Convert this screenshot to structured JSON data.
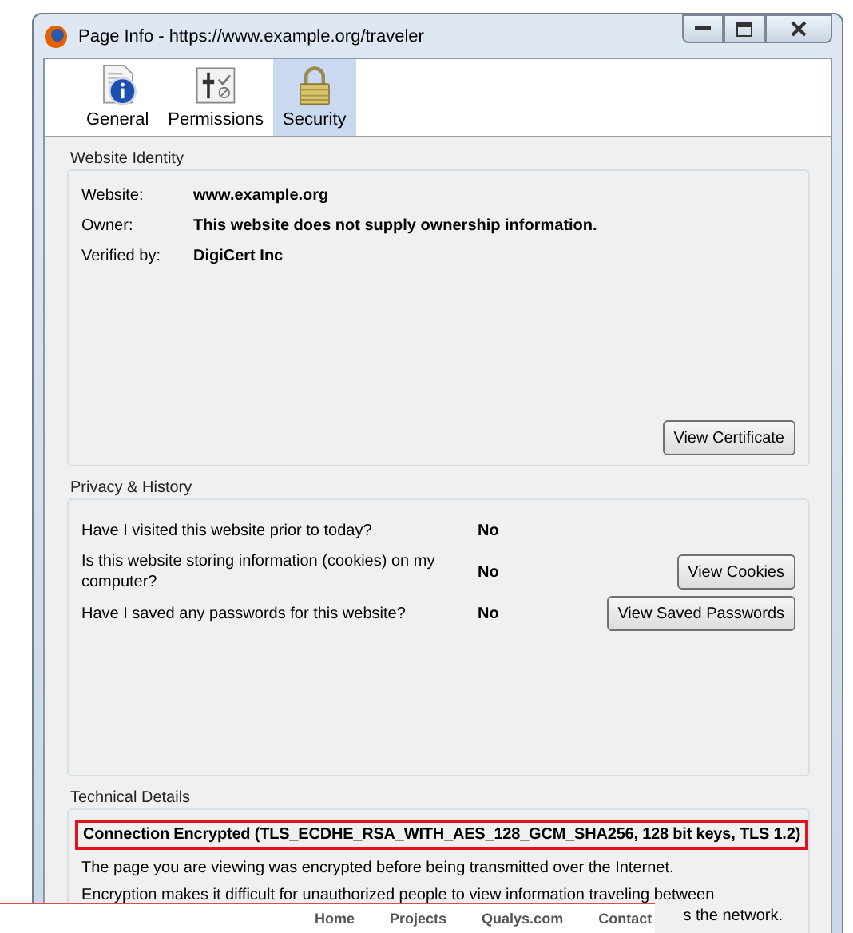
{
  "window": {
    "title": "Page Info - https://www.example.org/traveler"
  },
  "tabs": [
    {
      "label": "General",
      "kind": "info",
      "selected": false
    },
    {
      "label": "Permissions",
      "kind": "permissions",
      "selected": false
    },
    {
      "label": "Security",
      "kind": "lock",
      "selected": true
    }
  ],
  "identity": {
    "title": "Website Identity",
    "fields": [
      {
        "label": "Website:",
        "value": "www.example.org"
      },
      {
        "label": "Owner:",
        "value": "This website does not supply ownership information."
      },
      {
        "label": "Verified by:",
        "value": "DigiCert Inc"
      }
    ],
    "button": "View Certificate"
  },
  "privacy": {
    "title": "Privacy & History",
    "rows": [
      {
        "question": "Have I visited this website prior to today?",
        "answer": "No"
      },
      {
        "question": "Is this website storing information (cookies) on my computer?",
        "answer": "No",
        "button": "View Cookies"
      },
      {
        "question": "Have I saved any passwords for this website?",
        "answer": "No",
        "button": "View Saved Passwords"
      }
    ]
  },
  "technical": {
    "title": "Technical Details",
    "headline": "Connection Encrypted (TLS_ECDHE_RSA_WITH_AES_128_GCM_SHA256, 128 bit keys, TLS 1.2)",
    "lines": [
      "The page you are viewing was encrypted before being transmitted over the Internet.",
      "Encryption makes it difficult for unauthorized people to view information traveling between"
    ],
    "line_tail": "s the network."
  },
  "footer_nav": [
    "Home",
    "Projects",
    "Qualys.com",
    "Contact"
  ]
}
